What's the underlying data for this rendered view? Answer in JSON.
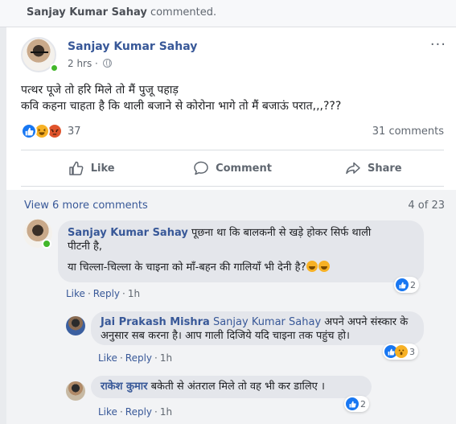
{
  "activity": {
    "actor": "Sanjay Kumar Sahay",
    "verb": "commented."
  },
  "post": {
    "author": "Sanjay Kumar Sahay",
    "time": "2 hrs ·",
    "more_label": "···",
    "text_line1": "पत्थर पूजे तो हरि मिले तो मैं पुजू पहाड़",
    "text_line2": "कवि कहना चाहता है कि थाली बजाने से कोरोना भागे तो मैं बजाऊं परात,,,???",
    "reaction_count": "37",
    "comments_count": "31 comments",
    "reaction_icons": [
      "like-icon",
      "haha-icon",
      "angry-icon"
    ]
  },
  "actions": {
    "like": "Like",
    "comment": "Comment",
    "share": "Share"
  },
  "comments_section": {
    "view_more": "View 6 more comments",
    "pager": "4 of 23",
    "like_label": "Like",
    "reply_label": "Reply",
    "items": [
      {
        "author": "Sanjay Kumar Sahay",
        "text1": " पूछना था कि बालकनी से खड़े होकर सिर्फ थाली",
        "text2": "पीटनी है,",
        "text3": "या चिल्ला-चिल्ला के चाइना को माँ-बहन की गालियाँ भी देनी है?",
        "time": "1h",
        "reaction_count": "2"
      },
      {
        "author": "Jai Prakash Mishra",
        "tag": "Sanjay Kumar Sahay",
        "text1": " अपने अपने संस्कार के",
        "text2": "अनुसार सब करना है। आप गाली दिजिये यदि चाइना तक पहुंच हो।",
        "time": "1h",
        "reaction_count": "3"
      },
      {
        "author": "राकेश कुमार",
        "text1": " बकेती से अंतराल मिले तो वह भी कर डालिए ।",
        "time": "1h",
        "reaction_count": "2"
      }
    ]
  },
  "colors": {
    "link": "#385898",
    "muted": "#606770",
    "like_blue": "#1877f2",
    "online_green": "#42b72a",
    "bubble_bg": "#e4e6eb"
  }
}
